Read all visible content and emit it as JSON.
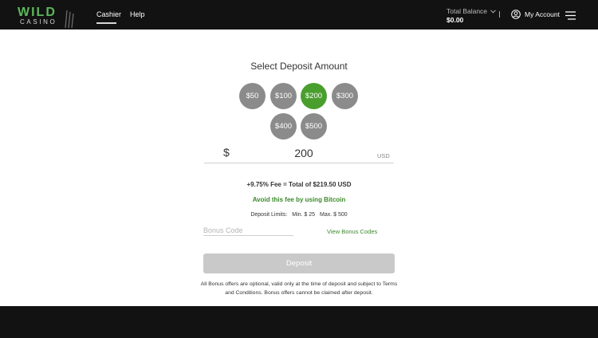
{
  "header": {
    "logo_main": "WILD",
    "logo_sub": "CASINO",
    "nav": [
      {
        "label": "Cashier"
      },
      {
        "label": "Help"
      }
    ],
    "balance_label": "Total Balance",
    "balance_amount": "$0.00",
    "account_label": "My Account",
    "icons": {
      "balance": "chevron-down-icon",
      "account": "user-circle-icon",
      "menu": "hamburger-menu-icon"
    }
  },
  "deposit": {
    "title": "Select Deposit Amount",
    "amounts": [
      {
        "label": "$50",
        "selected": false
      },
      {
        "label": "$100",
        "selected": false
      },
      {
        "label": "$200",
        "selected": true
      },
      {
        "label": "$300",
        "selected": false
      },
      {
        "label": "$400",
        "selected": false
      },
      {
        "label": "$500",
        "selected": false
      }
    ],
    "currency_symbol": "$",
    "amount_value": "200",
    "currency_code": "USD",
    "fee_text": "+9.75% Fee = Total of $219.50 USD",
    "bitcoin_text": "Avoid this fee by using Bitcoin",
    "limits_label": "Deposit Limits:",
    "limits_min": "Min. $ 25",
    "limits_max": "Max. $ 500",
    "bonus_placeholder": "Bonus Code",
    "view_bonus_label": "View Bonus Codes",
    "deposit_button": "Deposit",
    "disclaimer": "All Bonus offers are optional, valid only at the time of deposit and subject to Terms and Conditions. Bonus offers cannot be claimed after deposit."
  },
  "colors": {
    "accent_green": "#4a9e2e",
    "chip_gray": "#8b8b8b",
    "header_bg": "#121212",
    "button_disabled": "#c9c9c9"
  }
}
